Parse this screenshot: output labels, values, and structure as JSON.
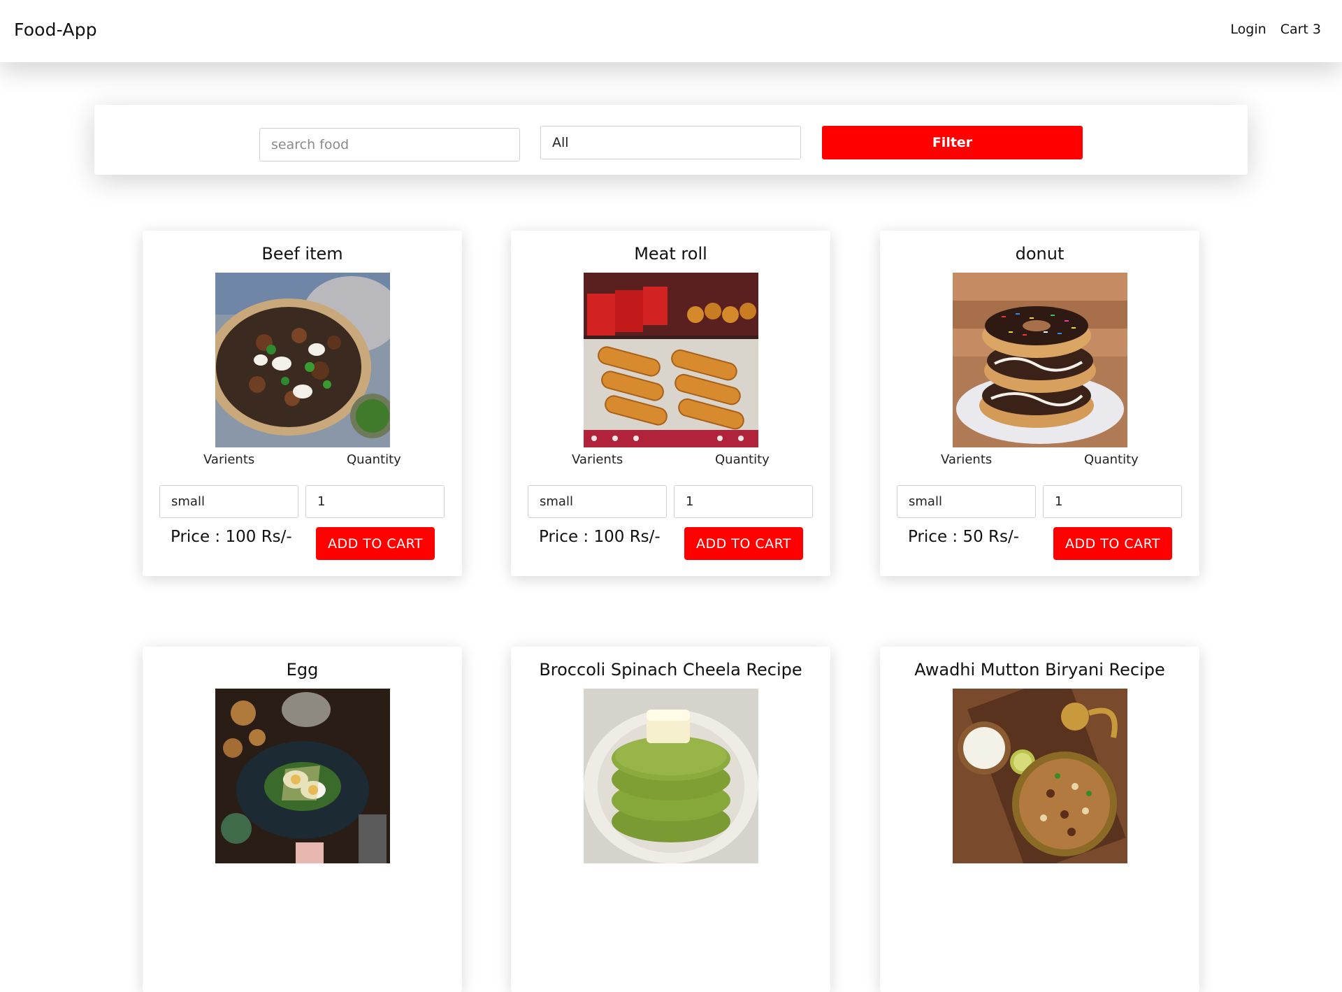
{
  "navbar": {
    "brand": "Food-App",
    "links": [
      "Login",
      "Cart 3"
    ]
  },
  "filter": {
    "search_placeholder": "search food",
    "category_value": "All",
    "button_label": "Filter"
  },
  "labels": {
    "variants": "Varients",
    "quantity": "Quantity"
  },
  "items": [
    {
      "name": "Beef item",
      "variant": "small",
      "quantity": "1",
      "price": "Price : 100 Rs/-",
      "button": "ADD TO CART",
      "image": "beef-dish-image"
    },
    {
      "name": "Meat roll",
      "variant": "small",
      "quantity": "1",
      "price": "Price : 100 Rs/-",
      "button": "ADD TO CART",
      "image": "meat-roll-image"
    },
    {
      "name": "donut",
      "variant": "small",
      "quantity": "1",
      "price": "Price : 50 Rs/-",
      "button": "ADD TO CART",
      "image": "donut-image"
    },
    {
      "name": "Egg",
      "variant": "",
      "quantity": "",
      "price": "",
      "button": "",
      "image": "egg-dish-image"
    },
    {
      "name": "Broccoli Spinach Cheela Recipe",
      "variant": "",
      "quantity": "",
      "price": "",
      "button": "",
      "image": "cheela-image"
    },
    {
      "name": "Awadhi Mutton Biryani Recipe",
      "variant": "",
      "quantity": "",
      "price": "",
      "button": "",
      "image": "biryani-image"
    }
  ],
  "colors": {
    "accent": "#ff0000",
    "background": "#ffffff",
    "text": "#111111"
  }
}
